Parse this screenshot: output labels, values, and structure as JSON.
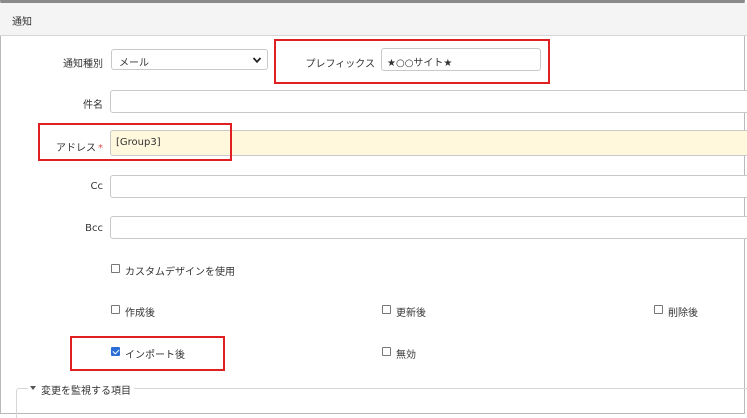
{
  "header": {
    "title": "通知"
  },
  "form": {
    "notify_type": {
      "label": "通知種別",
      "value": "メール"
    },
    "prefix": {
      "label": "プレフィックス",
      "value": "★○○サイト★"
    },
    "subject": {
      "label": "件名",
      "value": ""
    },
    "address": {
      "label": "アドレス",
      "required_mark": "*",
      "value": "[Group3]"
    },
    "cc": {
      "label": "Cc",
      "value": ""
    },
    "bcc": {
      "label": "Bcc",
      "value": ""
    },
    "custom_design": {
      "label": "カスタムデザインを使用",
      "checked": false
    },
    "after_create": {
      "label": "作成後",
      "checked": false
    },
    "after_update": {
      "label": "更新後",
      "checked": false
    },
    "after_delete": {
      "label": "削除後",
      "checked": false
    },
    "after_import": {
      "label": "インポート後",
      "checked": true
    },
    "disabled": {
      "label": "無効",
      "checked": false
    }
  },
  "section": {
    "legend": "変更を監視する項目"
  },
  "colors": {
    "highlight": "#e02020",
    "address_bg": "#fff8dc",
    "checkbox_accent": "#2b6fd6"
  }
}
